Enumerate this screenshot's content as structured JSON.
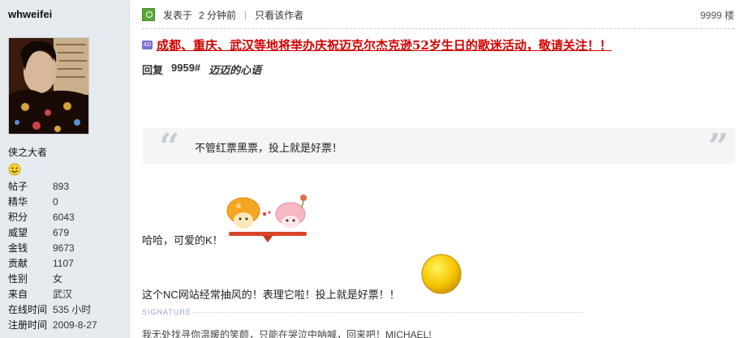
{
  "user": {
    "name": "whweifei",
    "title": "侠之大者",
    "stats": [
      {
        "label": "帖子",
        "value": "893"
      },
      {
        "label": "精华",
        "value": "0"
      },
      {
        "label": "积分",
        "value": "6043"
      },
      {
        "label": "威望",
        "value": "679"
      },
      {
        "label": "金钱",
        "value": "9673"
      },
      {
        "label": "贡献",
        "value": "1107"
      },
      {
        "label": "性别",
        "value": "女"
      },
      {
        "label": "来自",
        "value": "武汉"
      },
      {
        "label": "在线时间",
        "value": "535 小时"
      },
      {
        "label": "注册时间",
        "value": "2009-8-27"
      }
    ]
  },
  "post": {
    "posted_label": "发表于",
    "posted_time": "2 分钟前",
    "separator": "|",
    "only_author": "只看该作者",
    "floor": "9999 楼",
    "ad_badge": "AD",
    "ad_text": "成都、重庆、武汉等地将举办庆祝迈克尔杰克逊52岁生日的歌迷活动，敬请关注！！",
    "reply_label": "回复",
    "reply_num": "9959#",
    "reply_title": "迈迈的心语",
    "quote": "不管红票黑票，投上就是好票！",
    "line1": "哈哈，可爱的K！",
    "line2": "这个NC网站经常抽风的！表理它啦！投上就是好票！！",
    "signature_label": "SIGNATURE",
    "signature": "我无处找寻你温暖的笑颜，只能在哭泣中呐喊，回来吧！MICHAEL!"
  },
  "colors": {
    "sidebar_bg": "#e6ebef",
    "ad_red": "#d10000",
    "online_green": "#5aa63a"
  }
}
